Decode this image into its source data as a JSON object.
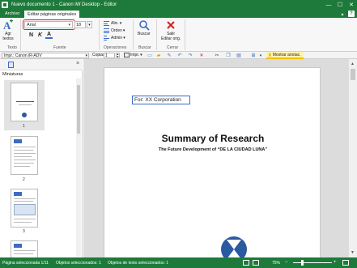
{
  "window": {
    "title": "Nuevo documento 1 - Canon iW Desktop - Editor",
    "minimize": "—",
    "maximize": "☐",
    "close": "✕"
  },
  "tabs": {
    "file": "Archivo",
    "edit": "Editar páginas originales",
    "help": "?",
    "ribbon_toggle": "▴"
  },
  "ribbon": {
    "text_group": {
      "add_text_label": "Agr\ntextos",
      "group": "Texto"
    },
    "font_group": {
      "font_name": "Arial",
      "font_size": "18",
      "bold": "N",
      "italic": "K",
      "color": "A",
      "group": "Fuente"
    },
    "ops_group": {
      "align": "Alin.",
      "order": "Orden",
      "admin": "Admin",
      "group": "Operaciones"
    },
    "search_group": {
      "search": "Buscar",
      "group": "Buscar"
    },
    "close_group": {
      "exit": "Salir\nEditar orig.",
      "group": "Cerrar"
    }
  },
  "toolbar": {
    "printer": "Impr.: Canon iR-ADV",
    "copies_label": "Copias",
    "copies_value": "1",
    "print_label": "Impr.",
    "show_annotations": "Mostrar anotac."
  },
  "thumbnails": {
    "title": "Miniaturas",
    "pages": [
      "1",
      "2",
      "3"
    ]
  },
  "document": {
    "textbox": "For: XX Corporation",
    "title": "Summary of Research",
    "subtitle": "The Future Development of “DE LA CIUDAD LUNA”"
  },
  "status": {
    "selected_page": "Página seleccionada 1/11",
    "selected_objects": "Objetos seleccionados: 1",
    "selected_text_objects": "Objetos de texto seleccionados: 1",
    "zoom": "75%",
    "zoom_minus": "−",
    "zoom_plus": "+"
  },
  "colors": {
    "brand": "#1e7a3a",
    "highlight": "#e02020",
    "selection": "#3b6cc4"
  }
}
